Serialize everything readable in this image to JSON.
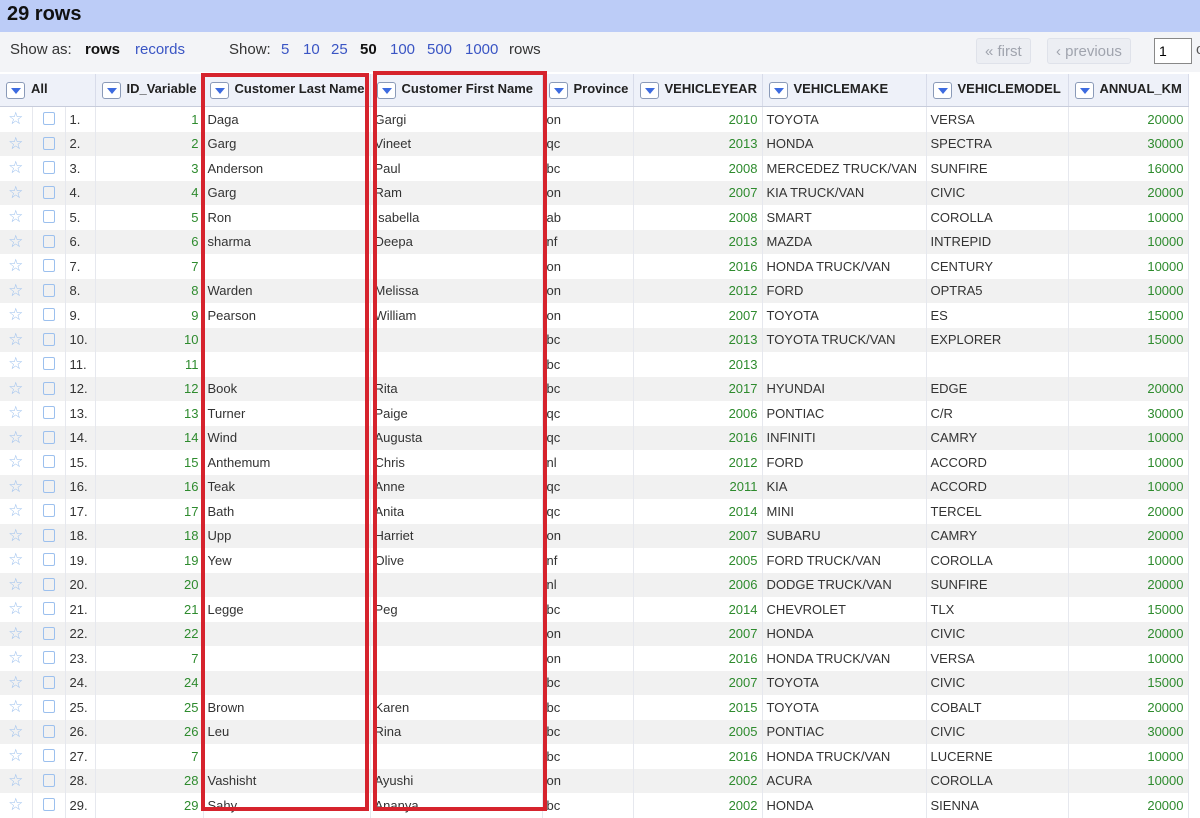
{
  "header": {
    "title": "29 rows"
  },
  "controls": {
    "show_as_label": "Show as:",
    "rows_mode": "rows",
    "records_mode": "records",
    "show_label": "Show:",
    "page_sizes": [
      "5",
      "10",
      "25",
      "50",
      "100",
      "500",
      "1000"
    ],
    "active_page_size": "50",
    "rows_suffix": "rows",
    "first_label": "« first",
    "previous_label": "‹ previous",
    "page_number": "1",
    "page_of": "o"
  },
  "columns": [
    "All",
    "ID_Variable",
    "Customer Last Name",
    "Customer First Name",
    "Province",
    "VEHICLEYEAR",
    "VEHICLEMAKE",
    "VEHICLEMODEL",
    "ANNUAL_KM"
  ],
  "rows": [
    [
      "1.",
      "1",
      "Daga",
      "Gargi",
      "on",
      "2010",
      "TOYOTA",
      "VERSA",
      "20000"
    ],
    [
      "2.",
      "2",
      "Garg",
      "Vineet",
      "qc",
      "2013",
      "HONDA",
      "SPECTRA",
      "30000"
    ],
    [
      "3.",
      "3",
      "Anderson",
      "Paul",
      "bc",
      "2008",
      "MERCEDEZ TRUCK/VAN",
      "SUNFIRE",
      "16000"
    ],
    [
      "4.",
      "4",
      "Garg",
      "Ram",
      "on",
      "2007",
      "KIA TRUCK/VAN",
      "CIVIC",
      "20000"
    ],
    [
      "5.",
      "5",
      "Ron",
      "Isabella",
      "ab",
      "2008",
      "SMART",
      "COROLLA",
      "10000"
    ],
    [
      "6.",
      "6",
      "sharma",
      "Deepa",
      "nf",
      "2013",
      "MAZDA",
      "INTREPID",
      "10000"
    ],
    [
      "7.",
      "7",
      "",
      "",
      "on",
      "2016",
      "HONDA TRUCK/VAN",
      "CENTURY",
      "10000"
    ],
    [
      "8.",
      "8",
      "Warden",
      "Melissa",
      "on",
      "2012",
      "FORD",
      "OPTRA5",
      "10000"
    ],
    [
      "9.",
      "9",
      "Pearson",
      "William",
      "on",
      "2007",
      "TOYOTA",
      "ES",
      "15000"
    ],
    [
      "10.",
      "10",
      "",
      "",
      "bc",
      "2013",
      "TOYOTA TRUCK/VAN",
      "EXPLORER",
      "15000"
    ],
    [
      "11.",
      "11",
      "",
      "",
      "bc",
      "2013",
      "",
      "",
      ""
    ],
    [
      "12.",
      "12",
      "Book",
      "Rita",
      "bc",
      "2017",
      "HYUNDAI",
      "EDGE",
      "20000"
    ],
    [
      "13.",
      "13",
      "Turner",
      "Paige",
      "qc",
      "2006",
      "PONTIAC",
      "C/R",
      "30000"
    ],
    [
      "14.",
      "14",
      "Wind",
      "Augusta",
      "qc",
      "2016",
      "INFINITI",
      "CAMRY",
      "10000"
    ],
    [
      "15.",
      "15",
      "Anthemum",
      "Chris",
      "nl",
      "2012",
      "FORD",
      "ACCORD",
      "10000"
    ],
    [
      "16.",
      "16",
      "Teak",
      "Anne",
      "qc",
      "2011",
      "KIA",
      "ACCORD",
      "10000"
    ],
    [
      "17.",
      "17",
      "Bath",
      "Anita",
      "qc",
      "2014",
      "MINI",
      "TERCEL",
      "20000"
    ],
    [
      "18.",
      "18",
      "Upp",
      "Harriet",
      "on",
      "2007",
      "SUBARU",
      "CAMRY",
      "20000"
    ],
    [
      "19.",
      "19",
      "Yew",
      "Olive",
      "nf",
      "2005",
      "FORD TRUCK/VAN",
      "COROLLA",
      "10000"
    ],
    [
      "20.",
      "20",
      "",
      "",
      "nl",
      "2006",
      "DODGE TRUCK/VAN",
      "SUNFIRE",
      "20000"
    ],
    [
      "21.",
      "21",
      "Legge",
      "Peg",
      "bc",
      "2014",
      "CHEVROLET",
      "TLX",
      "15000"
    ],
    [
      "22.",
      "22",
      "",
      "",
      "on",
      "2007",
      "HONDA",
      "CIVIC",
      "20000"
    ],
    [
      "23.",
      "7",
      "",
      "",
      "on",
      "2016",
      "HONDA TRUCK/VAN",
      "VERSA",
      "10000"
    ],
    [
      "24.",
      "24",
      "",
      "",
      "bc",
      "2007",
      "TOYOTA",
      "CIVIC",
      "15000"
    ],
    [
      "25.",
      "25",
      "Brown",
      "Karen",
      "bc",
      "2015",
      "TOYOTA",
      "COBALT",
      "20000"
    ],
    [
      "26.",
      "26",
      "Leu",
      "Rina",
      "bc",
      "2005",
      "PONTIAC",
      "CIVIC",
      "30000"
    ],
    [
      "27.",
      "7",
      "",
      "",
      "bc",
      "2016",
      "HONDA TRUCK/VAN",
      "LUCERNE",
      "10000"
    ],
    [
      "28.",
      "28",
      "Vashisht",
      "Ayushi",
      "on",
      "2002",
      "ACURA",
      "COROLLA",
      "10000"
    ],
    [
      "29.",
      "29",
      "Sahy",
      "Ananya",
      "bc",
      "2002",
      "HONDA",
      "SIENNA",
      "20000"
    ]
  ],
  "colors": {
    "title_bar": "#bcccf7",
    "numeric_text": "#2e8b2e",
    "highlight": "#d6232d",
    "link": "#3a55c4"
  }
}
